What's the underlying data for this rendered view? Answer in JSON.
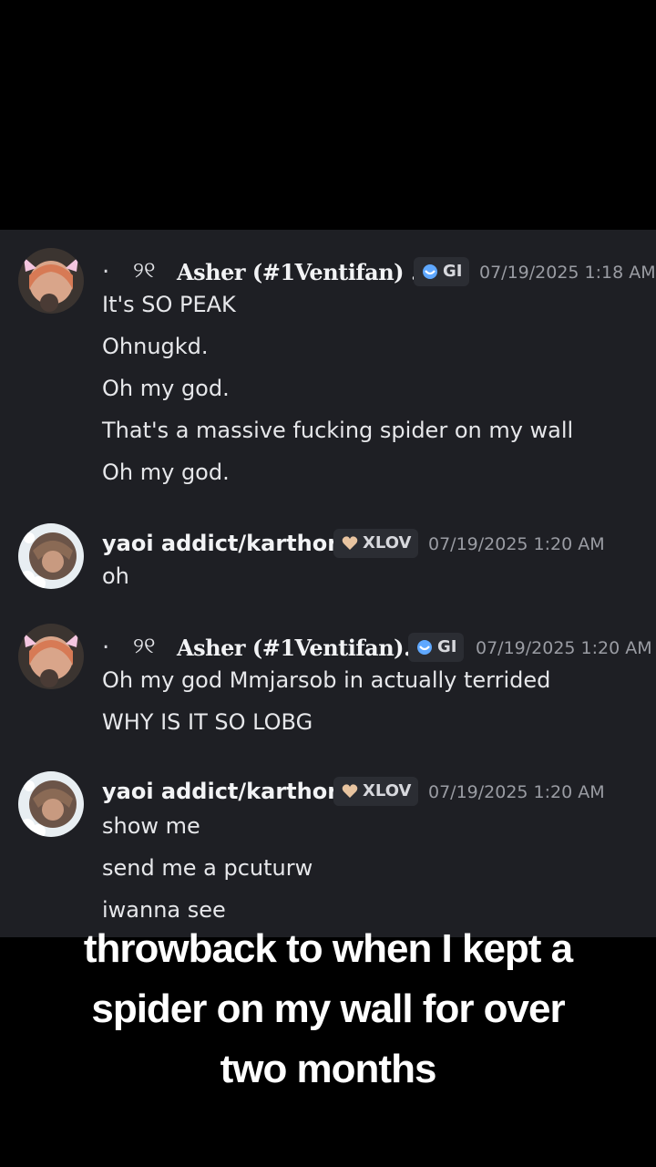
{
  "messages": [
    {
      "author": "Asher (#1Ventifan) . ...",
      "prefix_dot": ".",
      "prefix_glyph": "୨୧",
      "tag": "GI",
      "timestamp": "07/19/2025 1:18 AM",
      "lines": [
        "It's SO PEAK",
        "Ohnugkd.",
        "Oh my god.",
        "That's a massive fucking spider on my wall",
        "Oh my god."
      ]
    },
    {
      "author": "yaoi addict/karthon",
      "tag": "XLOV",
      "timestamp": "07/19/2025 1:20 AM",
      "lines": [
        "oh"
      ]
    },
    {
      "author": "Asher (#1Ventifan)...",
      "prefix_dot": ".",
      "prefix_glyph": "୨୧",
      "tag": "GI",
      "timestamp": "07/19/2025 1:20 AM",
      "lines": [
        "Oh my god Mmjarsob in actually terrided",
        "WHY IS IT SO LOBG"
      ]
    },
    {
      "author": "yaoi addict/karthon",
      "tag": "XLOV",
      "timestamp": "07/19/2025 1:20 AM",
      "lines": [
        "show me",
        "send me a pcuturw",
        "iwanna see"
      ]
    }
  ],
  "caption": {
    "line1": "throwback to when I kept a",
    "line2": "spider on my wall for over",
    "line3": "two months"
  },
  "icons": {
    "gi_tag": "blue-swirl-icon",
    "xlov_tag": "heart-icon"
  },
  "colors": {
    "chat_bg": "#1e1f24",
    "gi_icon": "#5fa8ff",
    "xlov_icon": "#e8c4a0"
  }
}
